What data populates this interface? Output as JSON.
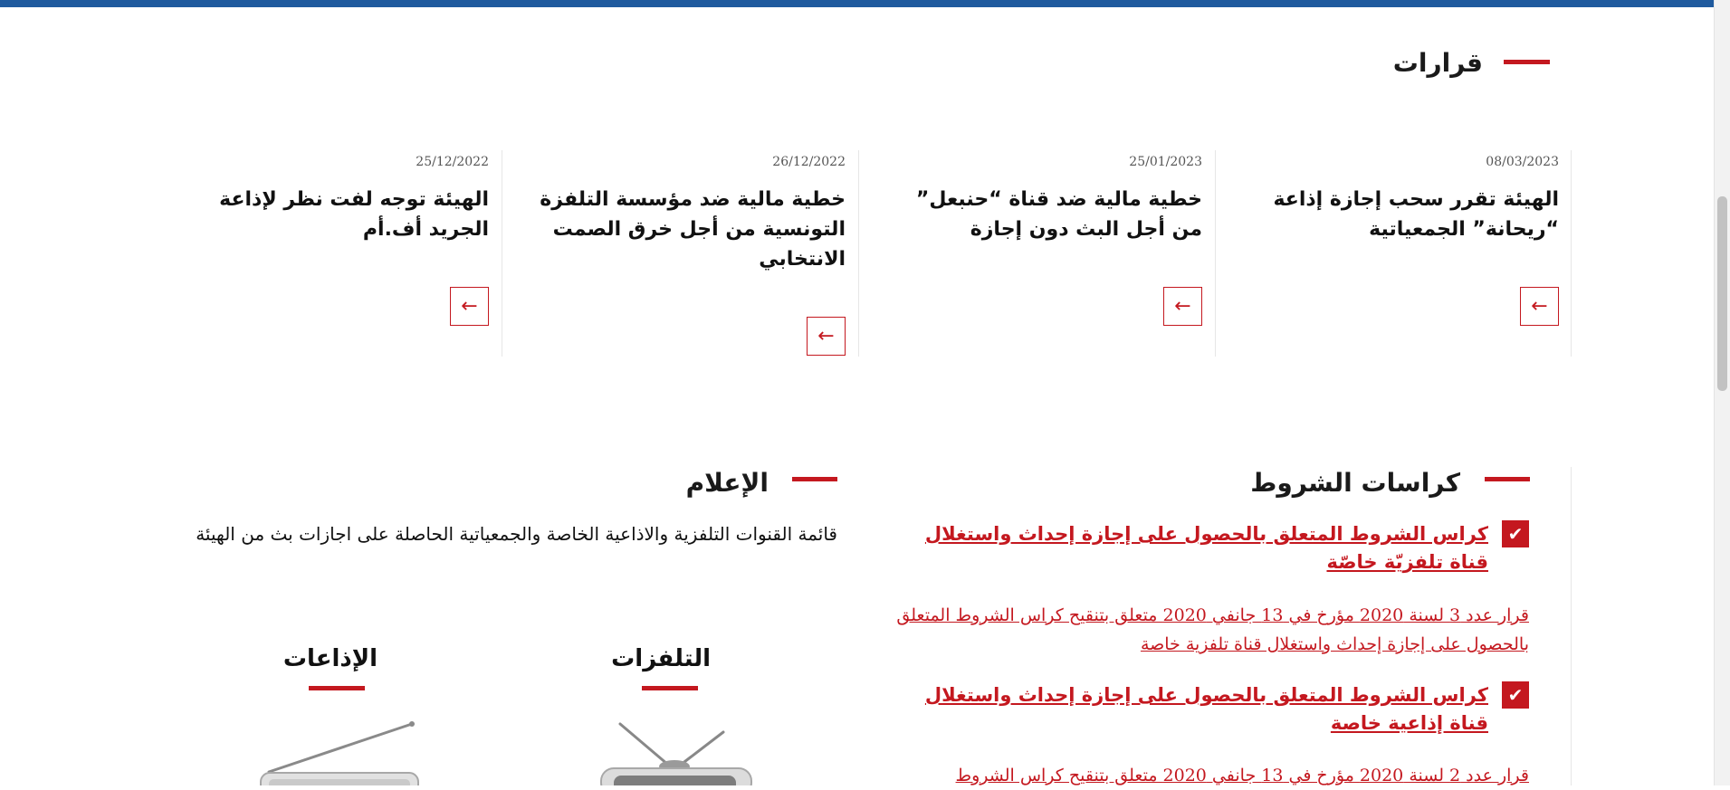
{
  "decisions": {
    "title": "قرارات",
    "cards": [
      {
        "date": "08/03/2023",
        "title": "الهيئة تقرر سحب إجازة إذاعة “ريحانة” الجمعياتية"
      },
      {
        "date": "25/01/2023",
        "title": "خطية مالية ضد قناة “حنبعل” من أجل البث دون إجازة"
      },
      {
        "date": "26/12/2022",
        "title": "خطية مالية ضد مؤسسة التلفزة التونسية من أجل خرق الصمت الانتخابي"
      },
      {
        "date": "25/12/2022",
        "title": "الهيئة توجه لفت نظر لإذاعة الجريد أف.أم"
      }
    ],
    "arrow_icon": "←"
  },
  "specs": {
    "title": "كراسات الشروط",
    "check_icon": "✔",
    "items": [
      {
        "main": "كراس الشروط المتعلق بالحصول على إجازة إحداث واستغلال قناة تلفزيّة خاصّة",
        "sub": "قرار عدد 3 لسنة 2020 مؤرخ في 13 جانفي 2020 متعلق بتنقيح كراس الشروط المتعلق بالحصول على إجازة إحداث واستغلال قناة تلفزية خاصة"
      },
      {
        "main": "كراس الشروط المتعلق بالحصول على إجازة إحداث واستغلال قناة إذاعية خاصة",
        "sub": "قرار عدد 2 لسنة 2020 مؤرخ في 13 جانفي 2020 متعلق بتنقيح كراس الشروط"
      }
    ]
  },
  "media": {
    "title": "الإعلام",
    "description": "قائمة القنوات التلفزية والاذاعية الخاصة والجمعياتية الحاصلة على اجازات بث من الهيئة",
    "tv_label": "التلفزات",
    "radio_label": "الإذاعات"
  },
  "colors": {
    "accent": "#c4181f",
    "topbar": "#1f5a9e"
  }
}
